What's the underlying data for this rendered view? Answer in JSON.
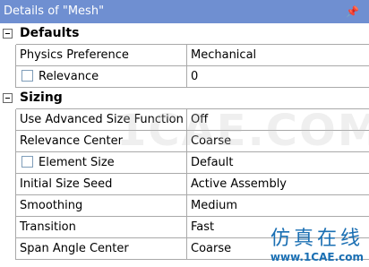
{
  "window": {
    "title": "Details of \"Mesh\"",
    "pin_icon": "pin-icon"
  },
  "groups": [
    {
      "title": "Defaults",
      "rows": [
        {
          "name": "Physics Preference",
          "value": "Mechanical",
          "checkbox": false
        },
        {
          "name": "Relevance",
          "value": "0",
          "checkbox": true
        }
      ]
    },
    {
      "title": "Sizing",
      "rows": [
        {
          "name": "Use Advanced Size Function",
          "value": "Off",
          "checkbox": false
        },
        {
          "name": "Relevance Center",
          "value": "Coarse",
          "checkbox": false
        },
        {
          "name": "Element Size",
          "value": "Default",
          "checkbox": true
        },
        {
          "name": "Initial Size Seed",
          "value": "Active Assembly",
          "checkbox": false
        },
        {
          "name": "Smoothing",
          "value": "Medium",
          "checkbox": false
        },
        {
          "name": "Transition",
          "value": "Fast",
          "checkbox": false
        },
        {
          "name": "Span Angle Center",
          "value": "Coarse",
          "checkbox": false
        }
      ]
    }
  ],
  "watermark": {
    "text": "1CAE.COM"
  },
  "logo": {
    "chinese": "仿真在线",
    "site": "www.1CAE.com"
  }
}
